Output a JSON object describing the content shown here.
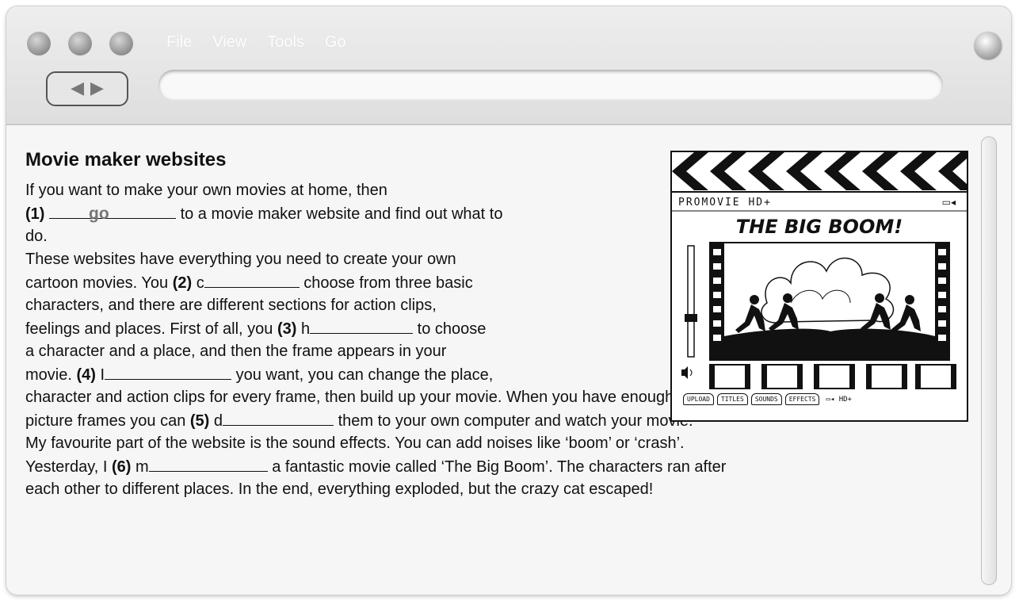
{
  "menu": [
    "File",
    "View",
    "Tools",
    "Go"
  ],
  "article": {
    "title": "Movie maker websites",
    "answer1": "go",
    "lines": [
      [
        {
          "t": "If you want to make your own movies at home, then"
        }
      ],
      [
        {
          "n": "(1)"
        },
        {
          "t": " "
        },
        {
          "ans": true,
          "w": 160
        },
        {
          "t": " to a movie maker website and find out what to"
        }
      ],
      [
        {
          "t": "do."
        }
      ],
      [
        {
          "t": "These websites have everything you need to create your own"
        }
      ],
      [
        {
          "t": "cartoon movies. You "
        },
        {
          "n": "(2)"
        },
        {
          "t": " c"
        },
        {
          "b": 120
        },
        {
          "t": "  choose from three basic"
        }
      ],
      [
        {
          "t": "characters, and there are different sections for action clips,"
        }
      ],
      [
        {
          "t": "feelings and places. First of all, you "
        },
        {
          "n": "(3)"
        },
        {
          "t": " h"
        },
        {
          "b": 130
        },
        {
          "t": " to choose"
        }
      ],
      [
        {
          "t": "a character and a place, and then the frame appears in your"
        }
      ],
      [
        {
          "t": "movie. "
        },
        {
          "n": "(4)"
        },
        {
          "t": " I"
        },
        {
          "b": 160
        },
        {
          "t": " you want, you can change the place,"
        }
      ],
      [
        {
          "t": "character and action clips for every frame, then build up your movie. When you have enough"
        }
      ],
      [
        {
          "t": "picture frames you can "
        },
        {
          "n": "(5)"
        },
        {
          "t": " d"
        },
        {
          "b": 140
        },
        {
          "t": " them to your own computer and watch your movie."
        }
      ],
      [
        {
          "t": "My favourite part of the website is the sound effects. You can add noises like ‘boom’ or ‘crash’."
        }
      ],
      [
        {
          "t": "Yesterday, I "
        },
        {
          "n": "(6)"
        },
        {
          "t": " m"
        },
        {
          "b": 150
        },
        {
          "t": " a fantastic movie called ‘The Big Boom’. The characters ran after"
        }
      ],
      [
        {
          "t": "each other to different places. In the end, everything exploded, but the crazy cat escaped!"
        }
      ]
    ]
  },
  "illustration": {
    "brand": "PROMOVIE HD+",
    "movie_title": "THE BIG BOOM!",
    "tabs": [
      "UPLOAD",
      "TITLES",
      "SOUNDS",
      "EFFECTS"
    ],
    "hd_label": "HD+"
  },
  "icons": [
    "back-arrow-icon",
    "forward-arrow-icon",
    "camera-icon",
    "speaker-icon",
    "clapperboard-icon"
  ]
}
